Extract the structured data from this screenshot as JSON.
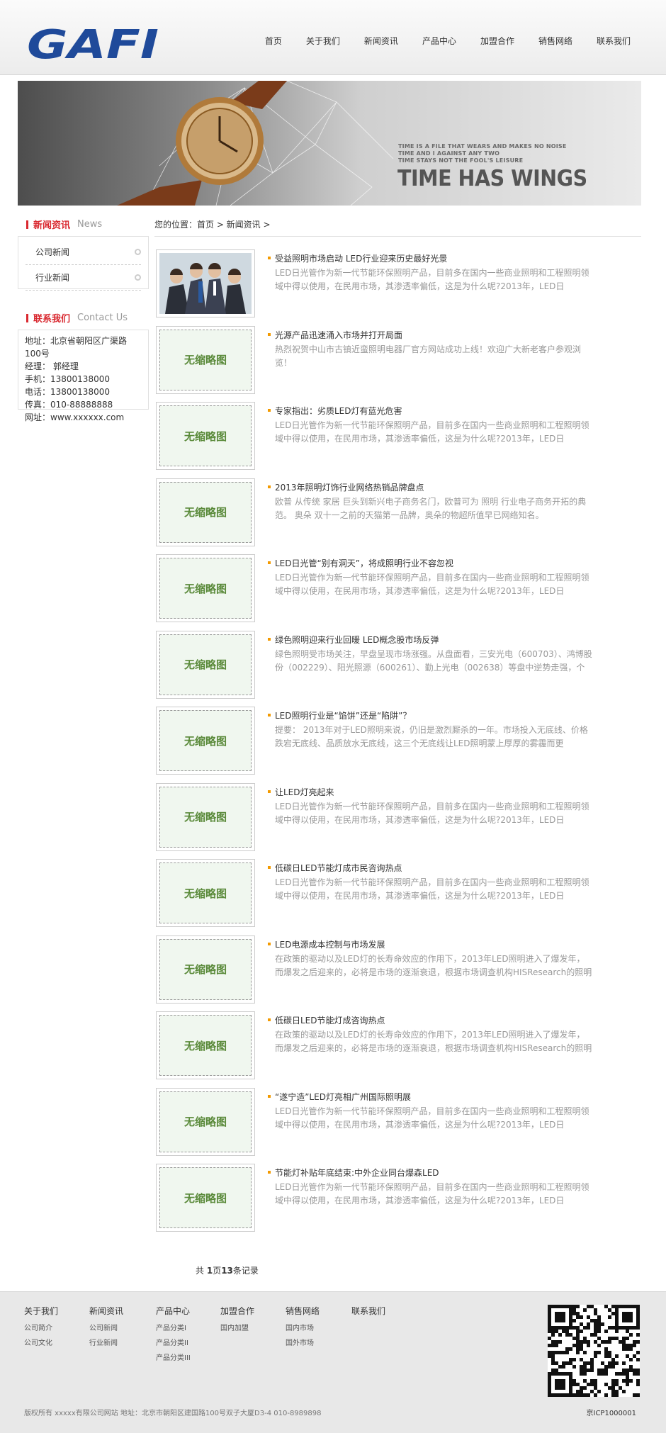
{
  "header": {
    "logo_text": "GAFI",
    "nav": [
      "首页",
      "关于我们",
      "新闻资讯",
      "产品中心",
      "加盟合作",
      "销售网络",
      "联系我们"
    ]
  },
  "banner": {
    "tagline_lines": [
      "TIME IS A FILE THAT WEARS AND MAKES NO NOISE",
      "TIME AND I AGAINST ANY TWO",
      "TIME STAYS NOT THE FOOL'S LEISURE"
    ],
    "headline": "TIME HAS WINGS"
  },
  "sidebar": {
    "news_box": {
      "title_cn": "新闻资讯",
      "title_en": "News",
      "items": [
        "公司新闻",
        "行业新闻"
      ]
    },
    "contact_box": {
      "title_cn": "联系我们",
      "title_en": "Contact Us",
      "lines": [
        "地址：北京省朝阳区广渠路100号",
        "经理： 郭经理",
        "手机：13800138000",
        "电话：13800138000",
        "传真：010-88888888",
        "网址：www.xxxxxx.com"
      ]
    }
  },
  "breadcrumb": "您的位置：首页 > 新闻资讯 >",
  "no_image_text": "无缩略图",
  "articles": [
    {
      "title": "受益照明市场启动 LED行业迎来历史最好光景",
      "summary": "LED日光管作为新一代节能环保照明产品，目前多在国内一些商业照明和工程照明领域中得以使用，在民用市场，其渗透率偏低，这是为什么呢?2013年，LED日",
      "has_photo": true
    },
    {
      "title": "光源产品迅速涌入市场并打开局面",
      "summary": "热烈祝贺中山市古镇近蛮照明电器厂官方网站成功上线！欢迎广大新老客户参观浏览！",
      "has_photo": false
    },
    {
      "title": "专家指出：劣质LED灯有蓝光危害",
      "summary": "LED日光管作为新一代节能环保照明产品，目前多在国内一些商业照明和工程照明领域中得以使用，在民用市场，其渗透率偏低，这是为什么呢?2013年，LED日",
      "has_photo": false
    },
    {
      "title": "2013年照明灯饰行业网络热销品牌盘点",
      "summary": "欧普 从传统 家居 巨头到新兴电子商务名门，欧普可为 照明 行业电子商务开拓的典范。 奥朵 双十一之前的天猫第一品牌，奥朵的物超所值早已网络知名。",
      "has_photo": false
    },
    {
      "title": "LED日光管“别有洞天”，将成照明行业不容忽视",
      "summary": "LED日光管作为新一代节能环保照明产品，目前多在国内一些商业照明和工程照明领域中得以使用，在民用市场，其渗透率偏低，这是为什么呢?2013年，LED日",
      "has_photo": false
    },
    {
      "title": "绿色照明迎来行业回暖 LED概念股市场反弹",
      "summary": "绿色照明受市场关注，早盘呈现市场涨强。从盘面看，三安光电（600703）、鸿博股份（002229）、阳光照源（600261）、勤上光电（002638）等盘中逆势走强，个",
      "has_photo": false
    },
    {
      "title": "LED照明行业是“馅饼”还是“陷阱”？",
      "summary": "提要： 2013年对于LED照明来说，仍旧是激烈厮杀的一年。市场投入无底线、价格跌宕无底线、品质放水无底线，这三个无底线让LED照明蒙上厚厚的雾霾而更",
      "has_photo": false
    },
    {
      "title": "让LED灯亮起来",
      "summary": "LED日光管作为新一代节能环保照明产品，目前多在国内一些商业照明和工程照明领域中得以使用，在民用市场，其渗透率偏低，这是为什么呢?2013年，LED日",
      "has_photo": false
    },
    {
      "title": "低碳日LED节能灯成市民咨询热点",
      "summary": "LED日光管作为新一代节能环保照明产品，目前多在国内一些商业照明和工程照明领域中得以使用，在民用市场，其渗透率偏低，这是为什么呢?2013年，LED日",
      "has_photo": false
    },
    {
      "title": "LED电源成本控制与市场发展",
      "summary": "在政策的驱动以及LED灯的长寿命效应的作用下，2013年LED照明进入了爆发年，而爆发之后迎来的，必将是市场的逐渐衰退，根据市场调查机构HISResearch的照明",
      "has_photo": false
    },
    {
      "title": "低碳日LED节能灯成咨询热点",
      "summary": "在政策的驱动以及LED灯的长寿命效应的作用下，2013年LED照明进入了爆发年，而爆发之后迎来的，必将是市场的逐渐衰退，根据市场调查机构HISResearch的照明",
      "has_photo": false
    },
    {
      "title": "“遂宁造”LED灯亮相广州国际照明展",
      "summary": "LED日光管作为新一代节能环保照明产品，目前多在国内一些商业照明和工程照明领域中得以使用，在民用市场，其渗透率偏低，这是为什么呢?2013年，LED日",
      "has_photo": false
    },
    {
      "title": "节能灯补贴年底结束:中外企业同台爆森LED",
      "summary": "LED日光管作为新一代节能环保照明产品，目前多在国内一些商业照明和工程照明领域中得以使用，在民用市场，其渗透率偏低，这是为什么呢?2013年，LED日",
      "has_photo": false
    }
  ],
  "pager": {
    "prefix": "共 ",
    "pages": "1",
    "mid": "页",
    "count": "13",
    "suffix": "条记录"
  },
  "footer": {
    "columns": [
      {
        "title": "关于我们",
        "items": [
          "公司简介",
          "公司文化"
        ]
      },
      {
        "title": "新闻资讯",
        "items": [
          "公司新闻",
          "行业新闻"
        ]
      },
      {
        "title": "产品中心",
        "items": [
          "产品分类I",
          "产品分类II",
          "产品分类III"
        ]
      },
      {
        "title": "加盟合作",
        "items": [
          "国内加盟"
        ]
      },
      {
        "title": "销售网络",
        "items": [
          "国内市场",
          "国外市场"
        ]
      },
      {
        "title": "联系我们",
        "items": []
      }
    ],
    "copyright": "版权所有 xxxxx有限公司网站 地址：北京市朝阳区建国路100号双子大厦D3-4 010-8989898",
    "icp": "京ICP1000001"
  }
}
